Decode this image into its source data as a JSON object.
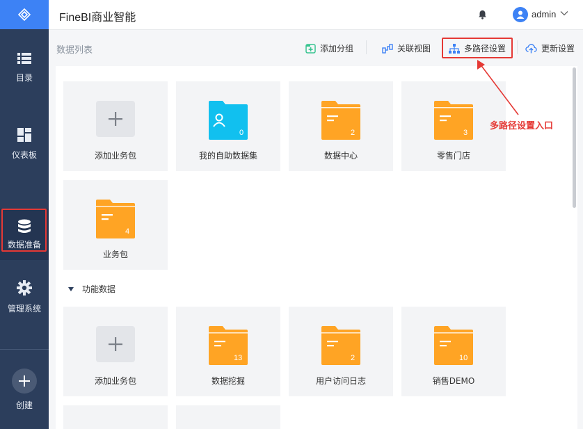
{
  "app": {
    "title": "FineBI商业智能"
  },
  "header": {
    "username": "admin"
  },
  "sidebar": {
    "items": [
      {
        "label": "目录"
      },
      {
        "label": "仪表板"
      },
      {
        "label": "数据准备"
      },
      {
        "label": "管理系统"
      }
    ],
    "create_label": "创建"
  },
  "toolbar": {
    "title": "数据列表",
    "add_group": "添加分组",
    "relation_view": "关联视图",
    "multipath": "多路径设置",
    "update_settings": "更新设置"
  },
  "annotation": {
    "text": "多路径设置入口"
  },
  "cards_top": [
    {
      "label": "添加业务包",
      "type": "add"
    },
    {
      "label": "我的自助数据集",
      "type": "self",
      "count": "0"
    },
    {
      "label": "数据中心",
      "type": "folder",
      "count": "2"
    },
    {
      "label": "零售门店",
      "type": "folder",
      "count": "3"
    },
    {
      "label": "业务包",
      "type": "folder",
      "count": "4"
    }
  ],
  "section": {
    "title": "功能数据"
  },
  "cards_func": [
    {
      "label": "添加业务包",
      "type": "add"
    },
    {
      "label": "数据挖掘",
      "type": "folder",
      "count": "13"
    },
    {
      "label": "用户访问日志",
      "type": "folder",
      "count": "2"
    },
    {
      "label": "销售DEMO",
      "type": "folder",
      "count": "10"
    }
  ],
  "colors": {
    "accent": "#3d82f5",
    "sidebar": "#2c3e5c",
    "folder": "#ffa424",
    "self_folder": "#11c0ef",
    "highlight": "#e53935"
  }
}
